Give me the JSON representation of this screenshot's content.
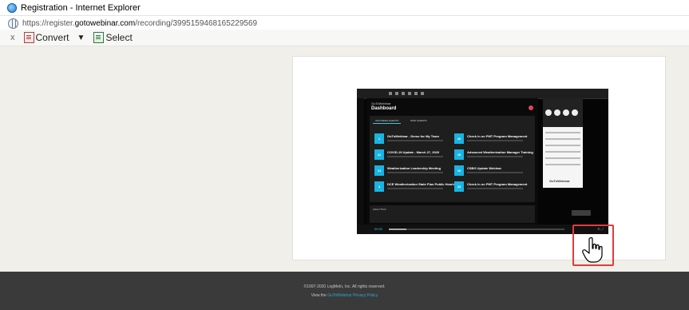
{
  "window": {
    "title": "Registration - Internet Explorer"
  },
  "address": {
    "prefix": "https://register.",
    "domain": "gotowebinar.com",
    "path": "/recording/3995159468165229569"
  },
  "toolbar": {
    "close_glyph": "x",
    "convert_label": "Convert",
    "select_label": "Select",
    "dropdown_glyph": "▼"
  },
  "video": {
    "dashboard": {
      "brand": "GoToWebinar",
      "heading": "Dashboard",
      "tabs": [
        "UPCOMING EVENTS",
        "PAST EVENTS"
      ],
      "events": [
        {
          "date": "1",
          "title": "GoToWebinar - Demo for My Team"
        },
        {
          "date": "26",
          "title": "Check in on PMT Program Management"
        },
        {
          "date": "12",
          "title": "COVID-19 Update - March 27, 2020"
        },
        {
          "date": "15",
          "title": "Advanced Weatherization Manager Training"
        },
        {
          "date": "14",
          "title": "Weatherization Leadership Meeting"
        },
        {
          "date": "16",
          "title": "CSBG Update Webinar"
        },
        {
          "date": "4",
          "title": "DCE Weatherization State Plan Public Hearing"
        },
        {
          "date": "23",
          "title": "Check in on PMT Program Management"
        }
      ],
      "analytics_label": "ANALYTICS"
    },
    "right_pane": {
      "logo": "GoToWebinar"
    },
    "controls": {
      "time": "00:00",
      "progress": 0.1
    }
  },
  "footer": {
    "copyright": "©1997-2020 LogMeIn, Inc. All rights reserved.",
    "link_prefix": "View the ",
    "link_text": "GoToWebinar Privacy Policy"
  },
  "colors": {
    "accent": "#19b4e0",
    "highlight": "#e23b3b",
    "footer_bg": "#3a3a3a"
  }
}
